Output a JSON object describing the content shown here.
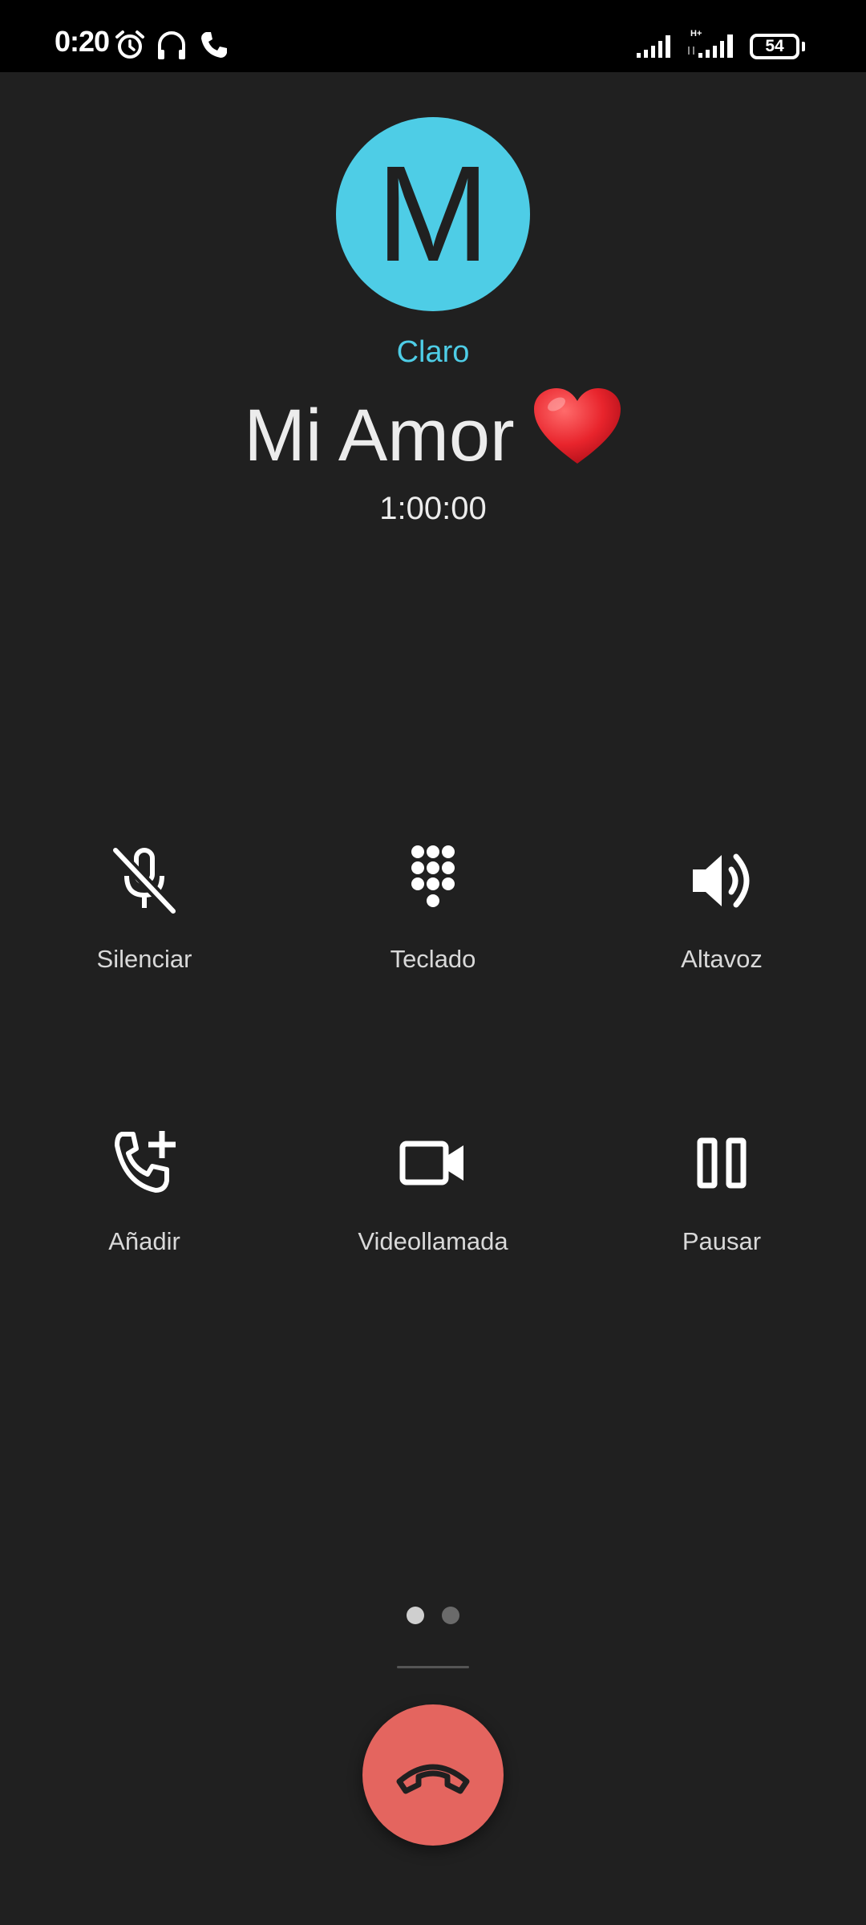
{
  "status_bar": {
    "time": "0:20",
    "icons": [
      "alarm-icon",
      "headset-icon",
      "phone-call-icon",
      "signal-icon",
      "hplus-signal-icon"
    ],
    "network_type": "H+",
    "battery_level": "54"
  },
  "contact": {
    "avatar_letter": "M",
    "avatar_color": "#4ecde6",
    "carrier": "Claro",
    "name": "Mi Amor",
    "name_emoji": "red-heart-emoji",
    "call_duration": "1:00:00"
  },
  "actions": [
    {
      "label": "Silenciar",
      "icon": "mic-off-icon"
    },
    {
      "label": "Teclado",
      "icon": "dialpad-icon"
    },
    {
      "label": "Altavoz",
      "icon": "speaker-icon"
    },
    {
      "label": "Añadir",
      "icon": "add-call-icon"
    },
    {
      "label": "Videollamada",
      "icon": "videocam-icon"
    },
    {
      "label": "Pausar",
      "icon": "pause-icon"
    }
  ],
  "pager": {
    "pages": 2,
    "active": 0
  },
  "end_call": {
    "icon": "call-end-icon",
    "color": "#e4655f"
  }
}
